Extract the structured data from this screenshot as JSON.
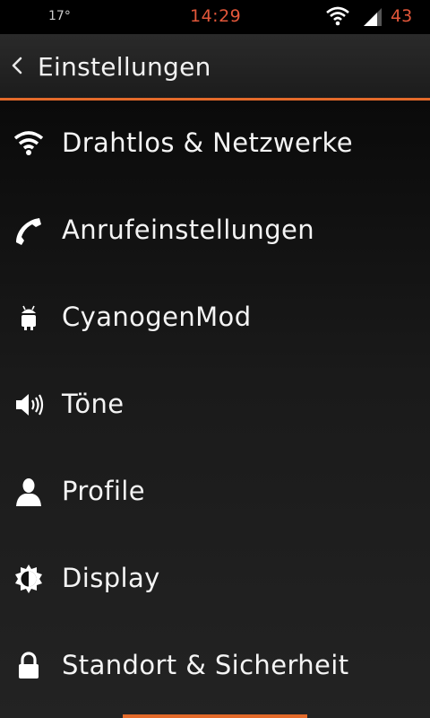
{
  "status_bar": {
    "temperature": "17°",
    "time": "14:29",
    "battery": "43",
    "accent_color": "#e2573a"
  },
  "header": {
    "title": "Einstellungen",
    "back_icon": "chevron-left-icon",
    "accent_color": "#e36a2a"
  },
  "settings": {
    "items": [
      {
        "label": "Drahtlos & Netzwerke",
        "icon": "wifi-icon"
      },
      {
        "label": "Anrufeinstellungen",
        "icon": "phone-icon"
      },
      {
        "label": "CyanogenMod",
        "icon": "android-icon"
      },
      {
        "label": "Töne",
        "icon": "speaker-icon"
      },
      {
        "label": "Profile",
        "icon": "person-icon"
      },
      {
        "label": "Display",
        "icon": "brightness-icon"
      },
      {
        "label": "Standort & Sicherheit",
        "icon": "lock-icon"
      }
    ]
  }
}
